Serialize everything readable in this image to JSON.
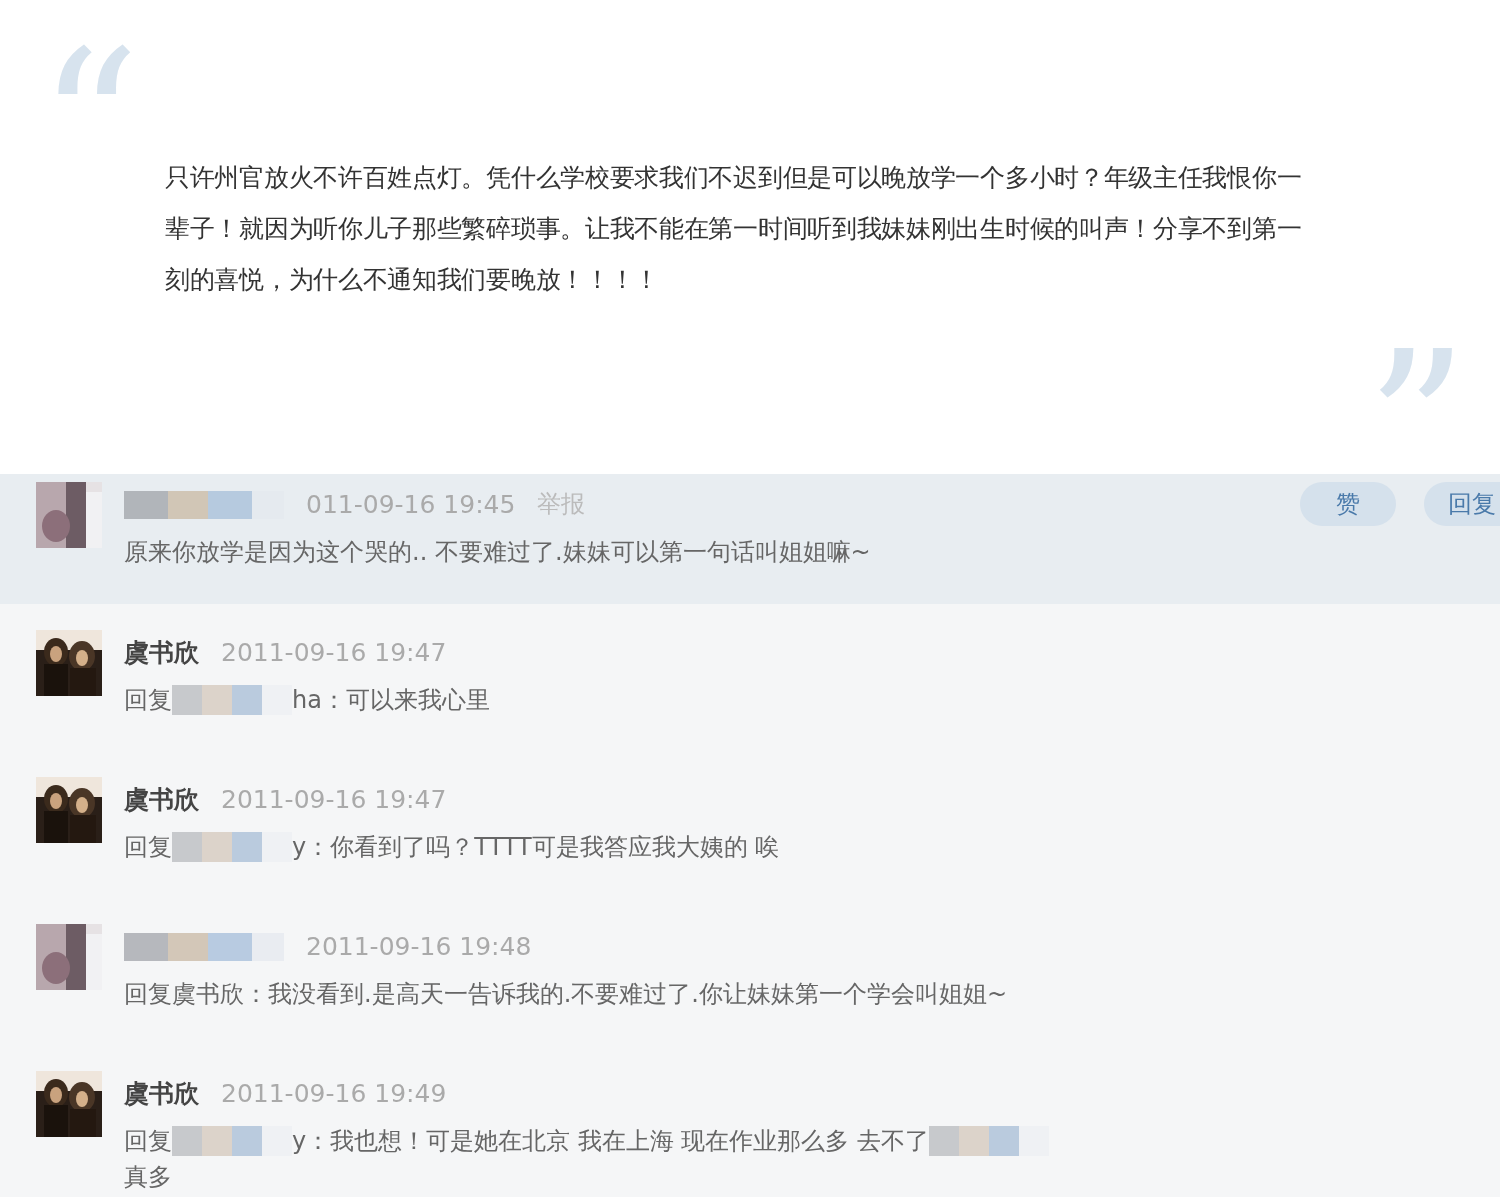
{
  "quote": {
    "open_mark": "“",
    "close_mark": "”",
    "text": "只许州官放火不许百姓点灯。凭什么学校要求我们不迟到但是可以晚放学一个多小时？年级主任我恨你一辈子！就因为听你儿子那些繁碎琐事。让我不能在第一时间听到我妹妹刚出生时候的叫声！分享不到第一刻的喜悦，为什么不通知我们要晚放！！！！"
  },
  "comments": [
    {
      "highlighted": true,
      "author_redacted": true,
      "time": "011-09-16 19:45",
      "report": "举报",
      "actions": [
        "赞",
        "回复"
      ],
      "body": [
        {
          "kind": "text",
          "text": "原来你放学是因为这个哭的..  不要难过了.妹妹可以第一句话叫姐姐嘛~"
        }
      ]
    },
    {
      "highlighted": false,
      "author": "虞书欣",
      "time": "2011-09-16 19:47",
      "body": [
        {
          "kind": "text",
          "text": "回复"
        },
        {
          "kind": "redacted"
        },
        {
          "kind": "text",
          "text": "ha：可以来我心里"
        }
      ]
    },
    {
      "highlighted": false,
      "author": "虞书欣",
      "time": "2011-09-16 19:47",
      "body": [
        {
          "kind": "text",
          "text": "回复"
        },
        {
          "kind": "redacted"
        },
        {
          "kind": "text",
          "text": "y：你看到了吗？TTTT可是我答应我大姨的  唉"
        }
      ]
    },
    {
      "highlighted": false,
      "author_redacted": true,
      "time": "2011-09-16 19:48",
      "body": [
        {
          "kind": "text",
          "text": "回复虞书欣：我没看到.是高天一告诉我的.不要难过了.你让妹妹第一个学会叫姐姐~"
        }
      ]
    },
    {
      "highlighted": false,
      "author": "虞书欣",
      "time": "2011-09-16 19:49",
      "body": [
        {
          "kind": "text",
          "text": "回复"
        },
        {
          "kind": "redacted"
        },
        {
          "kind": "text",
          "text": "y：我也想！可是她在北京 我在上海 现在作业那么多  去不了"
        },
        {
          "kind": "redacted"
        }
      ],
      "continuation": "真多"
    }
  ]
}
